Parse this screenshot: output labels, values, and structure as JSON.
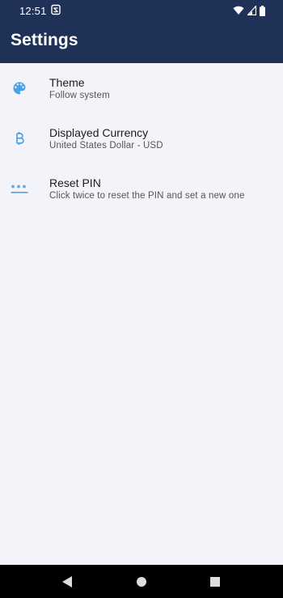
{
  "status_bar": {
    "time": "12:51",
    "icons": [
      "notification-icon",
      "wifi-icon",
      "signal-icon",
      "battery-icon"
    ]
  },
  "app_bar": {
    "title": "Settings",
    "background": "#1f3157"
  },
  "settings": [
    {
      "icon": "palette-icon",
      "title": "Theme",
      "subtitle": "Follow system"
    },
    {
      "icon": "bitcoin-icon",
      "title": "Displayed Currency",
      "subtitle": "United States Dollar - USD"
    },
    {
      "icon": "pin-icon",
      "title": "Reset PIN",
      "subtitle": "Click twice to reset the PIN and set a new one"
    }
  ],
  "accent_color": "#4aa3e6",
  "nav_bar": {
    "buttons": [
      "back-icon",
      "home-icon",
      "recents-icon"
    ]
  }
}
